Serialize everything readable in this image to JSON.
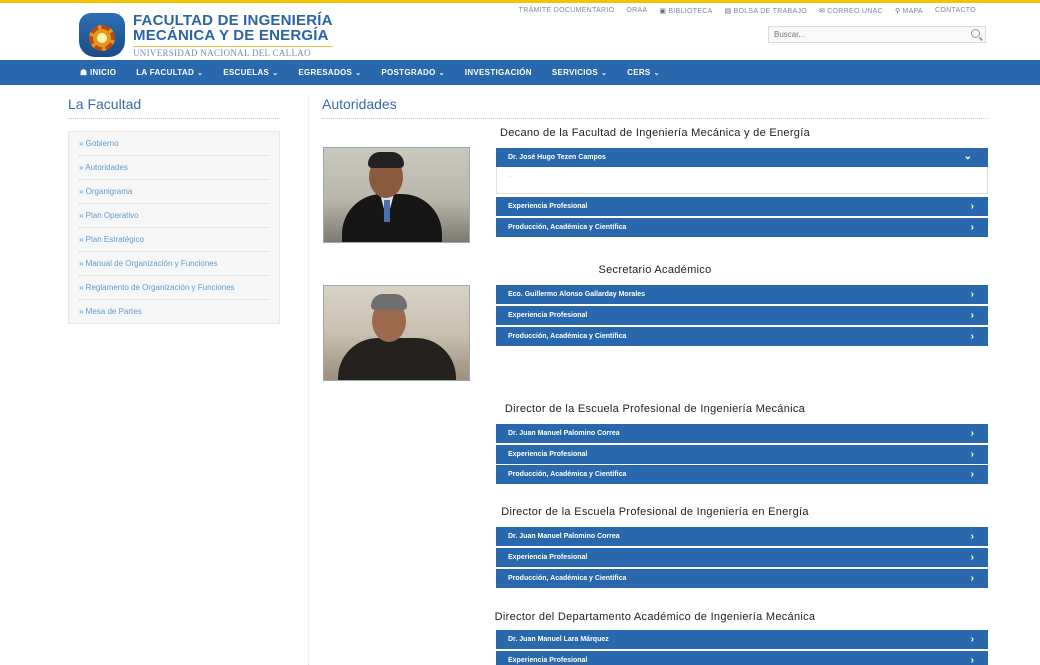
{
  "header": {
    "logo_line1": "FACULTAD DE INGENIERÍA",
    "logo_line2": "MECÁNICA Y DE ENERGÍA",
    "logo_line3": "UNIVERSIDAD NACIONAL DEL CALLAO",
    "util_links": [
      {
        "label": "TRÁMITE DOCUMENTARIO",
        "icon": ""
      },
      {
        "label": "ORAA",
        "icon": ""
      },
      {
        "label": "BIBLIOTECA",
        "icon": "book-icon"
      },
      {
        "label": "BOLSA DE TRABAJO",
        "icon": "briefcase-icon"
      },
      {
        "label": "CORREO UNAC",
        "icon": "mail-icon"
      },
      {
        "label": "MAPA",
        "icon": "map-pin-icon"
      },
      {
        "label": "CONTACTO",
        "icon": ""
      }
    ],
    "search_placeholder": "Buscar..."
  },
  "nav": {
    "items": [
      {
        "label": "INICIO",
        "icon": "home-icon",
        "dropdown": false
      },
      {
        "label": "LA FACULTAD",
        "dropdown": true
      },
      {
        "label": "ESCUELAS",
        "dropdown": true
      },
      {
        "label": "EGRESADOS",
        "dropdown": true
      },
      {
        "label": "POSTGRADO",
        "dropdown": true
      },
      {
        "label": "INVESTIGACIÓN",
        "dropdown": false
      },
      {
        "label": "SERVICIOS",
        "dropdown": true
      },
      {
        "label": "CERS",
        "dropdown": true
      }
    ]
  },
  "sidebar": {
    "title": "La Facultad",
    "items": [
      "» Gobierno",
      "» Autoridades",
      "» Organigrama",
      "» Plan Operativo",
      "» Plan Estratégico",
      "» Manual de Organización y Funciones",
      "» Reglamento de Organización y Funciones",
      "» Mesa de Partes"
    ]
  },
  "content": {
    "title": "Autoridades",
    "sections": [
      {
        "heading": "Decano de la Facultad de Ingeniería Mecánica y de Energía",
        "name": "Dr. José Hugo Tezen Campos",
        "experience": "Experiencia Profesional",
        "production": "Producción, Académica y Científica",
        "expanded_text": "-"
      },
      {
        "heading": "Secretario Académico",
        "name": "Eco. Guillermo Alonso Gallarday Morales",
        "experience": "Experiencia Profesional",
        "production": "Producción, Académica y Científica"
      },
      {
        "heading": "Director de la Escuela Profesional de Ingeniería Mecánica",
        "name": "Dr. Juan Manuel Palomino Correa",
        "experience": "Experiencia Profesional",
        "production": "Producción, Académica y Científica"
      },
      {
        "heading": "Director de la Escuela Profesional de Ingeniería en Energía",
        "name": "Dr. Juan Manuel Palomino Correa",
        "experience": "Experiencia Profesional",
        "production": "Producción, Académica y Científica"
      },
      {
        "heading": "Director del Departamento Académico de Ingeniería Mecánica",
        "name": "Dr. Juan Manuel Lara Márquez",
        "experience": "Experiencia Profesional"
      }
    ]
  },
  "colors": {
    "primary": "#2a68ad",
    "accent": "#f5c400",
    "link": "#5f9bd2"
  }
}
